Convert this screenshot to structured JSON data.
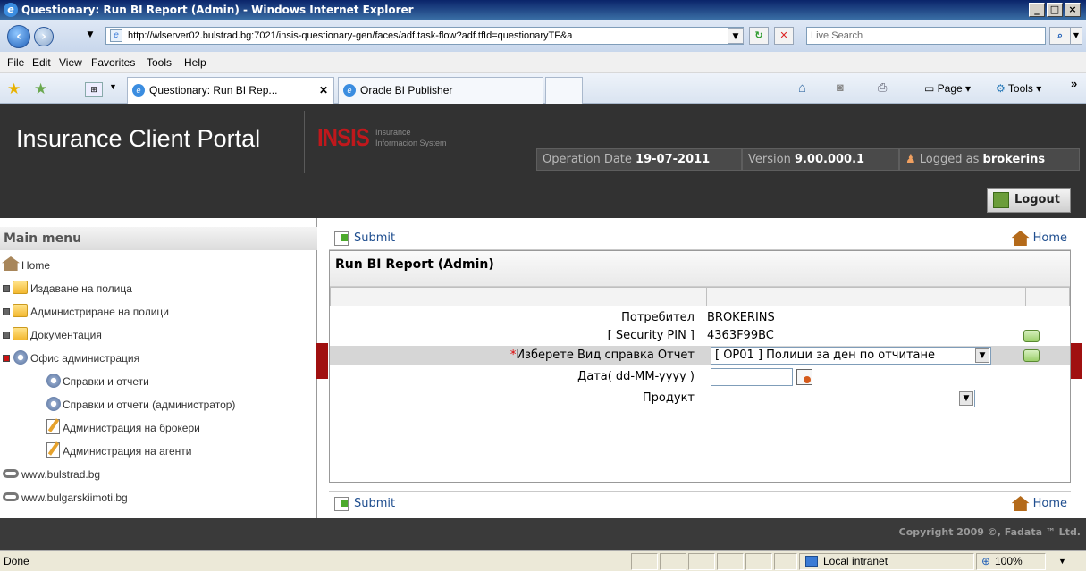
{
  "browser": {
    "title": "Questionary: Run BI Report (Admin) - Windows Internet Explorer",
    "url": "http://wlserver02.bulstrad.bg:7021/insis-questionary-gen/faces/adf.task-flow?adf.tfId=questionaryTF&a",
    "search_placeholder": "Live Search",
    "menu": [
      "File",
      "Edit",
      "View",
      "Favorites",
      "Tools",
      "Help"
    ],
    "tabs": [
      "Questionary: Run BI Rep...",
      "Oracle BI Publisher"
    ],
    "toolbar": {
      "page": "Page",
      "tools": "Tools",
      "more": "»"
    },
    "status": {
      "done": "Done",
      "zone": "Local intranet",
      "zoom": "100%"
    }
  },
  "portal": {
    "brand": "Insurance Client Portal",
    "insis_logo": "INSIS",
    "insis_sub1": "Insurance",
    "insis_sub2": "Informacion System",
    "operation_date_label": "Operation Date",
    "operation_date": "19-07-2011",
    "version_label": "Version",
    "version": "9.00.000.1",
    "logged_label": "Logged as",
    "user": "brokerins",
    "logout": "Logout",
    "footer": "Copyright 2009 ©, Fadata ™ Ltd."
  },
  "sidebar": {
    "title": "Main menu",
    "items": [
      {
        "label": "Home"
      },
      {
        "label": "Издаване на полица"
      },
      {
        "label": "Администриране на полици"
      },
      {
        "label": "Документация"
      },
      {
        "label": "Офис администрация"
      },
      {
        "label": "Справки и отчети"
      },
      {
        "label": "Справки и отчети (администратор)"
      },
      {
        "label": "Администрация на брокери"
      },
      {
        "label": "Администрация на агенти"
      },
      {
        "label": "www.bulstrad.bg"
      },
      {
        "label": "www.bulgarskiimoti.bg"
      }
    ]
  },
  "content": {
    "submit": "Submit",
    "home": "Home",
    "panel_title": "Run BI Report (Admin)",
    "fields": [
      {
        "label": "Потребител",
        "value": "BROKERINS"
      },
      {
        "label": "[ Security PIN ]",
        "value": "4363F99BC"
      },
      {
        "req": "*",
        "label": "Изберете Вид справка Отчет",
        "value": "[ OP01 ] Полици за ден по отчитане"
      },
      {
        "label": "Дата( dd-MM-yyyy )",
        "value": ""
      },
      {
        "label": "Продукт",
        "value": ""
      }
    ]
  }
}
